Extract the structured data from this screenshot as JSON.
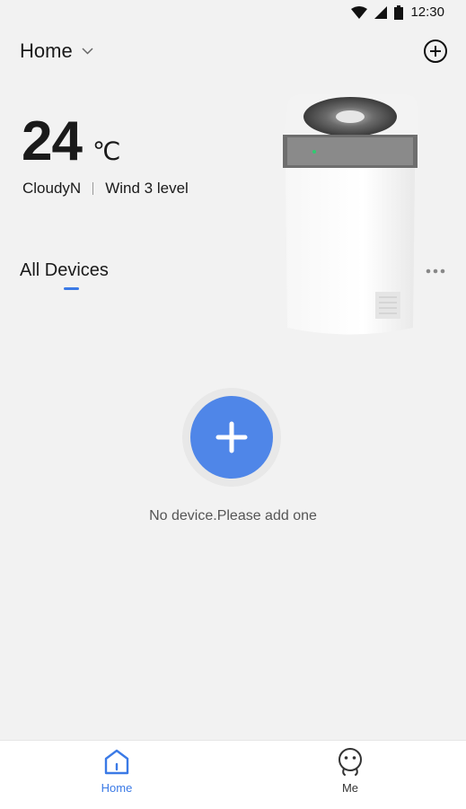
{
  "status_bar": {
    "time": "12:30"
  },
  "header": {
    "home_label": "Home"
  },
  "weather": {
    "temperature": "24",
    "unit": "℃",
    "condition": "CloudyN",
    "wind": "Wind 3 level"
  },
  "devices": {
    "title": "All Devices",
    "empty_message": "No device.Please add one"
  },
  "tabbar": {
    "items": [
      {
        "label": "Home",
        "active": true
      },
      {
        "label": "Me",
        "active": false
      }
    ]
  },
  "colors": {
    "accent": "#4f86e8",
    "background": "#f2f2f2",
    "tab_active": "#3b7ae6",
    "tab_inactive": "#333333"
  }
}
